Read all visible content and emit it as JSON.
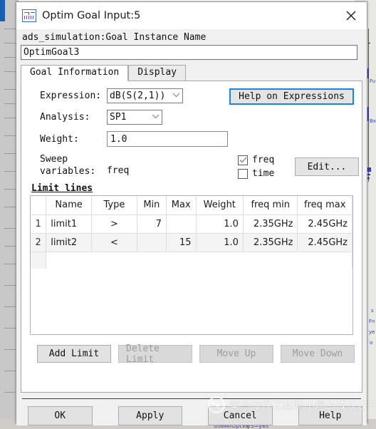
{
  "window": {
    "title": "Optim Goal Input:5",
    "icon": "waveform-icon",
    "close_label": "✕"
  },
  "instance": {
    "label": "ads_simulation:Goal Instance Name",
    "value": "OptimGoal3",
    "placeholder": ""
  },
  "tabs": [
    {
      "label": "Goal Information",
      "active": true
    },
    {
      "label": "Display",
      "active": false
    }
  ],
  "form": {
    "expression": {
      "label": "Expression:",
      "value": "dB(S(2,1))",
      "chevron": "⌄"
    },
    "analysis": {
      "label": "Analysis:",
      "value": "SP1",
      "chevron": "⌄"
    },
    "weight": {
      "label": "Weight:",
      "value": "1.0"
    },
    "sweep": {
      "label_line1": "Sweep",
      "label_line2": "variables:",
      "value": "freq"
    },
    "help_button": "Help on Expressions",
    "checkboxes": [
      {
        "label": "freq",
        "checked": true
      },
      {
        "label": "time",
        "checked": false
      }
    ],
    "edit_button": "Edit..."
  },
  "limit_section": {
    "title": "Limit lines",
    "columns": [
      "",
      "Name",
      "Type",
      "Min",
      "Max",
      "Weight",
      "freq min",
      "freq max"
    ],
    "rows": [
      {
        "index": "1",
        "name": "limit1",
        "type": ">",
        "min": "7",
        "max": "",
        "weight": "1.0",
        "freq_min": "2.35GHz",
        "freq_max": "2.45GHz"
      },
      {
        "index": "2",
        "name": "limit2",
        "type": "<",
        "min": "",
        "max": "15",
        "weight": "1.0",
        "freq_min": "2.35GHz",
        "freq_max": "2.45GHz"
      }
    ],
    "buttons": [
      {
        "label": "Add Limit",
        "enabled": true
      },
      {
        "label": "Delete Limit",
        "enabled": false
      },
      {
        "label": "Move Up",
        "enabled": false
      },
      {
        "label": "Move Down",
        "enabled": false
      }
    ]
  },
  "footer": {
    "buttons": [
      {
        "label": "OK"
      },
      {
        "label": "Apply"
      },
      {
        "label": "Cancel"
      },
      {
        "label": "Help"
      }
    ]
  },
  "watermark": {
    "text": "菜鸟硬件工程师小廖的成长日记",
    "logo": "wechat-icon"
  },
  "background": {
    "label_fu": "Fu",
    "label_bx": "Bx",
    "label_s": "s",
    "label_fn": "Fn",
    "label_ye": "ye",
    "label_o": "o",
    "bottom_text": "UseAllOptVars=yes"
  },
  "colors": {
    "accent_blue": "#1a84e2",
    "titlebar_bg": "#ffffff",
    "dialog_bg": "#f0f0f0",
    "panel_bg": "#ffffff",
    "wire_magenta": "#a0258c",
    "wire_blue": "#3a3ab0"
  }
}
